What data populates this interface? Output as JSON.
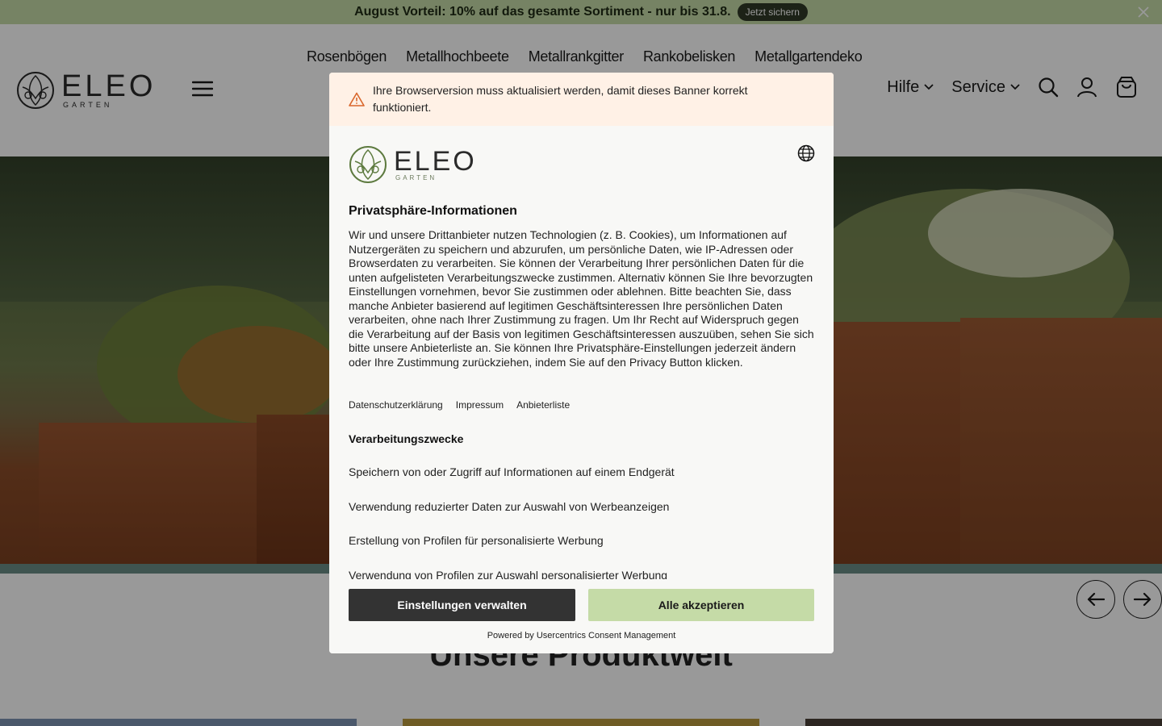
{
  "promo": {
    "text": "August Vorteil: 10% auf das gesamte Sortiment - nur bis 31.8.",
    "cta": "Jetzt sichern"
  },
  "header": {
    "categories": [
      "Rosenbögen",
      "Metallhochbeete",
      "Metallrankgitter",
      "Rankobelisken",
      "Metallgartendeko"
    ],
    "logo_main": "ELEO",
    "logo_sub": "GARTEN",
    "help": "Hilfe",
    "service": "Service"
  },
  "main": {
    "section_title": "Unsere Produktwelt"
  },
  "consent": {
    "warning": "Ihre Browserversion muss aktualisiert werden, damit dieses Banner korrekt funktioniert.",
    "logo_main": "ELEO",
    "logo_sub": "GARTEN",
    "title": "Privatsphäre-Informationen",
    "body": "Wir und unsere Drittanbieter nutzen Technologien (z. B. Cookies), um Informationen auf Nutzergeräten zu speichern und abzurufen, um persönliche Daten, wie IP-Adressen oder Browserdaten zu verarbeiten. Sie können der Verarbeitung Ihrer persönlichen Daten für die unten aufgelisteten Verarbeitungszwecke zustimmen. Alternativ können Sie Ihre bevorzugten Einstellungen vornehmen, bevor Sie zustimmen oder ablehnen. Bitte beachten Sie, dass manche Anbieter basierend auf legitimen Geschäftsinteressen Ihre persönlichen Daten verarbeiten, ohne nach Ihrer Zustimmung zu fragen. Um Ihr Recht auf Widerspruch gegen die Verarbeitung auf der Basis von legitimen Geschäftsinteressen auszuüben, sehen Sie sich bitte unsere Anbieterliste an. Sie können Ihre Privatsphäre-Einstellungen jederzeit ändern oder Ihre Zustimmung zurückziehen, indem Sie auf den Privacy Button klicken.",
    "links": [
      "Datenschutzerklärung",
      "Impressum",
      "Anbieterliste"
    ],
    "purposes_title": "Verarbeitungszwecke",
    "purposes": [
      "Speichern von oder Zugriff auf Informationen auf einem Endgerät",
      "Verwendung reduzierter Daten zur Auswahl von Werbeanzeigen",
      "Erstellung von Profilen für personalisierte Werbung",
      "Verwendung von Profilen zur Auswahl personalisierter Werbung"
    ],
    "btn_manage": "Einstellungen verwalten",
    "btn_accept": "Alle akzeptieren",
    "powered": "Powered by Usercentrics Consent Management"
  },
  "colors": {
    "promo_bg": "#c5dba7",
    "accent_green": "#c5dba7",
    "dark_button": "#333333",
    "warning_bg": "#fff1e6"
  }
}
